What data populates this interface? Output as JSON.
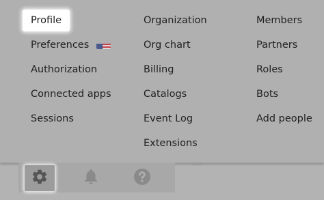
{
  "menu": {
    "columns": [
      {
        "items": [
          {
            "label": "Profile",
            "active": true
          },
          {
            "label": "Preferences",
            "flag_icon": "us-flag-icon"
          },
          {
            "label": "Authorization"
          },
          {
            "label": "Connected apps"
          },
          {
            "label": "Sessions"
          }
        ]
      },
      {
        "items": [
          {
            "label": "Organization"
          },
          {
            "label": "Org chart"
          },
          {
            "label": "Billing"
          },
          {
            "label": "Catalogs"
          },
          {
            "label": "Event Log"
          },
          {
            "label": "Extensions"
          }
        ]
      },
      {
        "items": [
          {
            "label": "Members"
          },
          {
            "label": "Partners"
          },
          {
            "label": "Roles"
          },
          {
            "label": "Bots"
          },
          {
            "label": "Add people"
          }
        ]
      }
    ]
  },
  "toolbar": {
    "buttons": [
      {
        "icon": "gear-icon",
        "active": true
      },
      {
        "icon": "bell-icon"
      },
      {
        "icon": "help-icon"
      }
    ]
  },
  "colors": {
    "overlay": "#b3b3b3",
    "active_item_bg": "#ffffff",
    "text": "#1f1f1f",
    "icon": "#555555"
  }
}
